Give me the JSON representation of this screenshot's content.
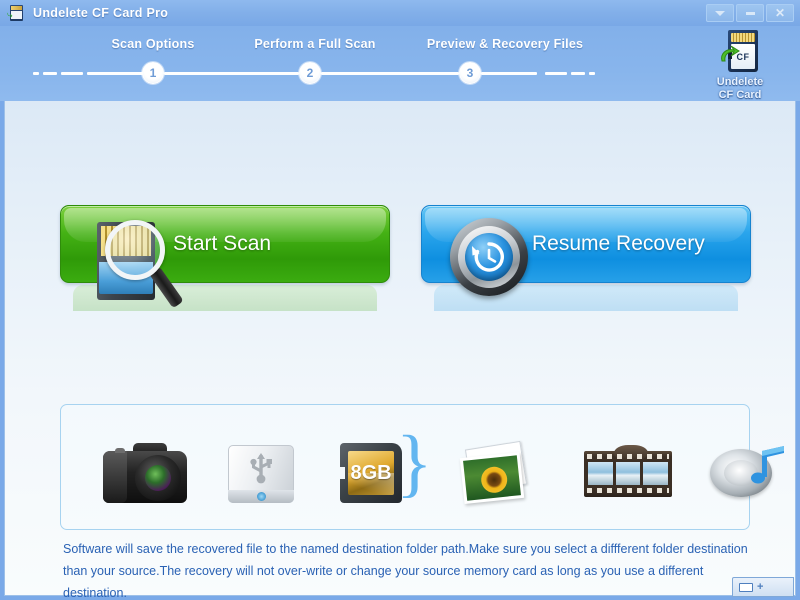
{
  "window": {
    "title": "Undelete CF Card Pro",
    "app_icon": "cf-card-icon",
    "controls": [
      {
        "name": "collapse-button",
        "icon": "chevron-down-icon",
        "label": ""
      },
      {
        "name": "minimize-button",
        "icon": "minimize-icon",
        "label": ""
      },
      {
        "name": "close-button",
        "icon": "close-icon",
        "label": "✕"
      }
    ]
  },
  "stepper": {
    "steps": [
      {
        "number": "1",
        "label": "Scan Options"
      },
      {
        "number": "2",
        "label": "Perform a Full Scan"
      },
      {
        "number": "3",
        "label": "Preview & Recovery Files"
      }
    ]
  },
  "logo": {
    "badge_text": "CF",
    "line1": "Undelete",
    "line2": "CF Card"
  },
  "actions": {
    "start_scan": {
      "label": "Start Scan",
      "icon": "scan-card-magnifier-icon",
      "color": "#3aa70d"
    },
    "resume_recovery": {
      "label": "Resume Recovery",
      "icon": "clock-restore-icon",
      "color": "#1c97e3"
    }
  },
  "device_panel": {
    "sources": [
      {
        "name": "camera-icon",
        "label": ""
      },
      {
        "name": "usb-drive-icon",
        "label": ""
      },
      {
        "name": "sd-card-icon",
        "label": "8",
        "unit": "GB"
      }
    ],
    "separator": "}",
    "results": [
      {
        "name": "photos-icon",
        "label": ""
      },
      {
        "name": "video-film-icon",
        "label": ""
      },
      {
        "name": "audio-speaker-icon",
        "label": ""
      }
    ]
  },
  "note": {
    "text": "Software will save the recovered file to the named destination folder path.Make sure you select a diffferent folder destination than your source.The recovery will not over-write or change your source memory card as long as you use a different destination."
  },
  "status_chip": {
    "plus": "+"
  },
  "colors": {
    "header_blue": "#88b5ec",
    "title_blue": "#82afe9",
    "green_button": "#3aa70d",
    "blue_button": "#1c97e3",
    "note_text": "#2a62b4",
    "panel_border": "#a7d3f0"
  }
}
